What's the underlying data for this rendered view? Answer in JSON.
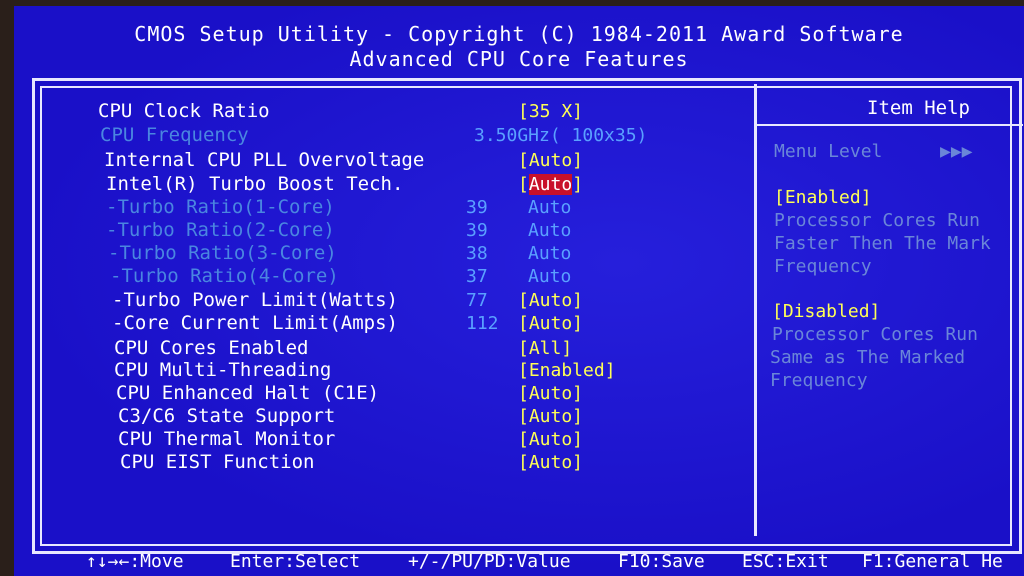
{
  "header": {
    "line1": "CMOS Setup Utility - Copyright (C) 1984-2011 Award Software",
    "line2": "Advanced CPU Core Features"
  },
  "settings": [
    {
      "label": "CPU Clock Ratio",
      "mid": "",
      "value": "[35 X]",
      "state": "normal"
    },
    {
      "label": "CPU Frequency",
      "mid": "3.50GHz( 100x35)",
      "value": "",
      "state": "dim"
    },
    {
      "label": "Internal CPU PLL Overvoltage",
      "mid": "",
      "value": "[Auto]",
      "state": "normal"
    },
    {
      "label": "Intel(R) Turbo Boost Tech.",
      "mid": "",
      "value": "Auto",
      "state": "selected"
    },
    {
      "label": "-Turbo Ratio(1-Core)",
      "mid": "39",
      "value": "Auto",
      "state": "dim"
    },
    {
      "label": "-Turbo Ratio(2-Core)",
      "mid": "39",
      "value": "Auto",
      "state": "dim"
    },
    {
      "label": "-Turbo Ratio(3-Core)",
      "mid": "38",
      "value": "Auto",
      "state": "dim"
    },
    {
      "label": "-Turbo Ratio(4-Core)",
      "mid": "37",
      "value": "Auto",
      "state": "dim"
    },
    {
      "label": "-Turbo Power Limit(Watts)",
      "mid": "77",
      "value": "[Auto]",
      "state": "normal"
    },
    {
      "label": "-Core Current Limit(Amps)",
      "mid": "112",
      "value": "[Auto]",
      "state": "normal"
    },
    {
      "label": "CPU Cores Enabled",
      "mid": "",
      "value": "[All]",
      "state": "normal"
    },
    {
      "label": "CPU Multi-Threading",
      "mid": "",
      "value": "[Enabled]",
      "state": "normal"
    },
    {
      "label": "CPU Enhanced Halt (C1E)",
      "mid": "",
      "value": "[Auto]",
      "state": "normal"
    },
    {
      "label": "C3/C6 State Support",
      "mid": "",
      "value": "[Auto]",
      "state": "normal"
    },
    {
      "label": "CPU Thermal Monitor",
      "mid": "",
      "value": "[Auto]",
      "state": "normal"
    },
    {
      "label": "CPU EIST Function",
      "mid": "",
      "value": "[Auto]",
      "state": "normal"
    }
  ],
  "help": {
    "title": "Item Help",
    "menu_level": "Menu Level",
    "menu_level_arrows": "▶▶▶",
    "enabled_tag": "[Enabled]",
    "enabled_lines": [
      "Processor Cores Run",
      "Faster Then The Mark",
      "Frequency"
    ],
    "disabled_tag": "[Disabled]",
    "disabled_lines": [
      "Processor Cores Run",
      "Same as The Marked",
      "Frequency"
    ]
  },
  "footer": {
    "move": "↑↓→←:Move",
    "select": "Enter:Select",
    "value": "+/-/PU/PD:Value",
    "save": "F10:Save",
    "exit": "ESC:Exit",
    "general": "F1:General He"
  }
}
